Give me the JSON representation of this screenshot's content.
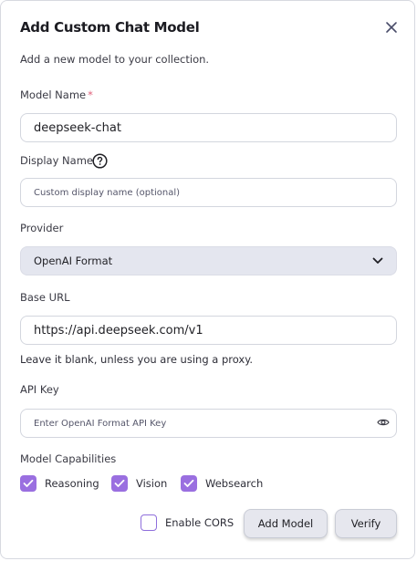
{
  "dialog": {
    "title": "Add Custom Chat Model",
    "subtitle": "Add a new model to your collection."
  },
  "model_name": {
    "label": "Model Name",
    "required_mark": "*",
    "value": "deepseek-chat"
  },
  "display_name": {
    "label": "Display Name",
    "placeholder": "Custom display name (optional)"
  },
  "provider": {
    "label": "Provider",
    "selected": "OpenAI Format"
  },
  "base_url": {
    "label": "Base URL",
    "value": "https://api.deepseek.com/v1",
    "hint": "Leave it blank, unless you are using a proxy."
  },
  "api_key": {
    "label": "API Key",
    "placeholder": "Enter OpenAI Format API Key"
  },
  "capabilities": {
    "label": "Model Capabilities",
    "items": [
      {
        "label": "Reasoning",
        "checked": true
      },
      {
        "label": "Vision",
        "checked": true
      },
      {
        "label": "Websearch",
        "checked": true
      }
    ]
  },
  "footer": {
    "cors_label": "Enable CORS",
    "cors_checked": false,
    "add_label": "Add Model",
    "verify_label": "Verify"
  },
  "colors": {
    "accent": "#9a6fe0",
    "required": "#e0607a"
  }
}
